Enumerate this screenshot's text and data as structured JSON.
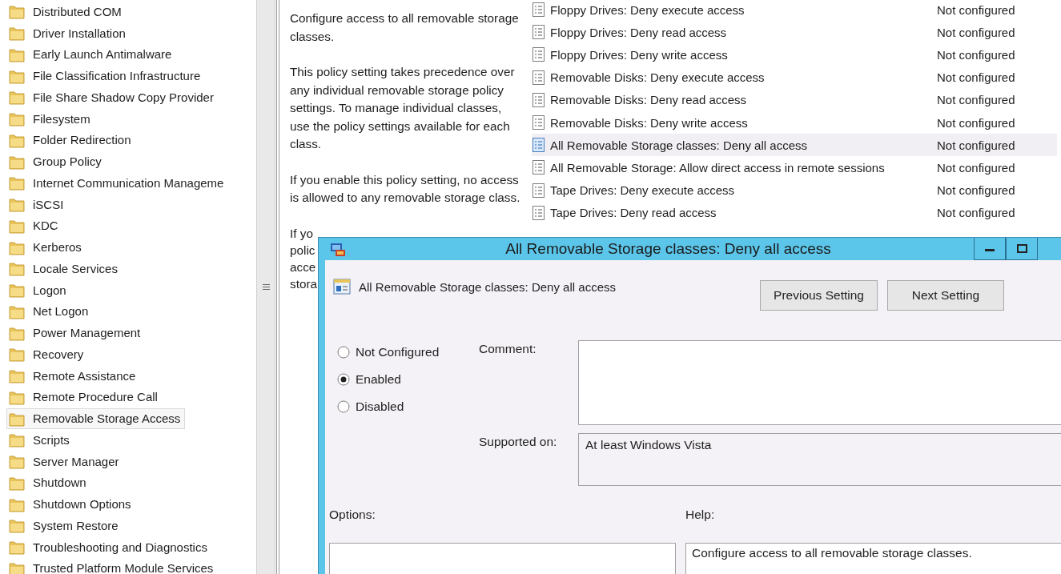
{
  "tree": {
    "items": [
      {
        "label": "Distributed COM",
        "selected": false
      },
      {
        "label": "Driver Installation",
        "selected": false
      },
      {
        "label": "Early Launch Antimalware",
        "selected": false
      },
      {
        "label": "File Classification Infrastructure",
        "selected": false
      },
      {
        "label": "File Share Shadow Copy Provider",
        "selected": false
      },
      {
        "label": "Filesystem",
        "selected": false
      },
      {
        "label": "Folder Redirection",
        "selected": false
      },
      {
        "label": "Group Policy",
        "selected": false
      },
      {
        "label": "Internet Communication Manageme",
        "selected": false
      },
      {
        "label": "iSCSI",
        "selected": false
      },
      {
        "label": "KDC",
        "selected": false
      },
      {
        "label": "Kerberos",
        "selected": false
      },
      {
        "label": "Locale Services",
        "selected": false
      },
      {
        "label": "Logon",
        "selected": false
      },
      {
        "label": "Net Logon",
        "selected": false
      },
      {
        "label": "Power Management",
        "selected": false
      },
      {
        "label": "Recovery",
        "selected": false
      },
      {
        "label": "Remote Assistance",
        "selected": false
      },
      {
        "label": "Remote Procedure Call",
        "selected": false
      },
      {
        "label": "Removable Storage Access",
        "selected": true
      },
      {
        "label": "Scripts",
        "selected": false
      },
      {
        "label": "Server Manager",
        "selected": false
      },
      {
        "label": "Shutdown",
        "selected": false
      },
      {
        "label": "Shutdown Options",
        "selected": false
      },
      {
        "label": "System Restore",
        "selected": false
      },
      {
        "label": "Troubleshooting and Diagnostics",
        "selected": false
      },
      {
        "label": "Trusted Platform Module Services",
        "selected": false
      }
    ]
  },
  "description": {
    "paragraphs": [
      "Configure access to all removable storage classes.",
      "This policy setting takes precedence over any individual removable storage policy settings. To manage individual classes, use the policy settings available for each class.",
      "If you enable this policy setting, no access is allowed to any removable storage class."
    ],
    "covered_lines": [
      "If yo",
      "polic",
      "acce",
      "stora"
    ]
  },
  "policies": {
    "rows": [
      {
        "name": "Floppy Drives: Deny execute access",
        "state": "Not configured",
        "selected": false
      },
      {
        "name": "Floppy Drives: Deny read access",
        "state": "Not configured",
        "selected": false
      },
      {
        "name": "Floppy Drives: Deny write access",
        "state": "Not configured",
        "selected": false
      },
      {
        "name": "Removable Disks: Deny execute access",
        "state": "Not configured",
        "selected": false
      },
      {
        "name": "Removable Disks: Deny read access",
        "state": "Not configured",
        "selected": false
      },
      {
        "name": "Removable Disks: Deny write access",
        "state": "Not configured",
        "selected": false
      },
      {
        "name": "All Removable Storage classes: Deny all access",
        "state": "Not configured",
        "selected": true
      },
      {
        "name": "All Removable Storage: Allow direct access in remote sessions",
        "state": "Not configured",
        "selected": false
      },
      {
        "name": "Tape Drives: Deny execute access",
        "state": "Not configured",
        "selected": false
      },
      {
        "name": "Tape Drives: Deny read access",
        "state": "Not configured",
        "selected": false
      }
    ]
  },
  "dialog": {
    "title": "All Removable Storage classes: Deny all access",
    "setting_name": "All Removable Storage classes: Deny all access",
    "buttons": [
      "Previous Setting",
      "Next Setting"
    ],
    "radios": [
      {
        "label": "Not Configured",
        "selected": false
      },
      {
        "label": "Enabled",
        "selected": true
      },
      {
        "label": "Disabled",
        "selected": false
      }
    ],
    "comment_label": "Comment:",
    "supported_label": "Supported on:",
    "supported_value": "At least Windows Vista",
    "options_label": "Options:",
    "help_label": "Help:",
    "help_text": "Configure access to all removable storage classes."
  }
}
